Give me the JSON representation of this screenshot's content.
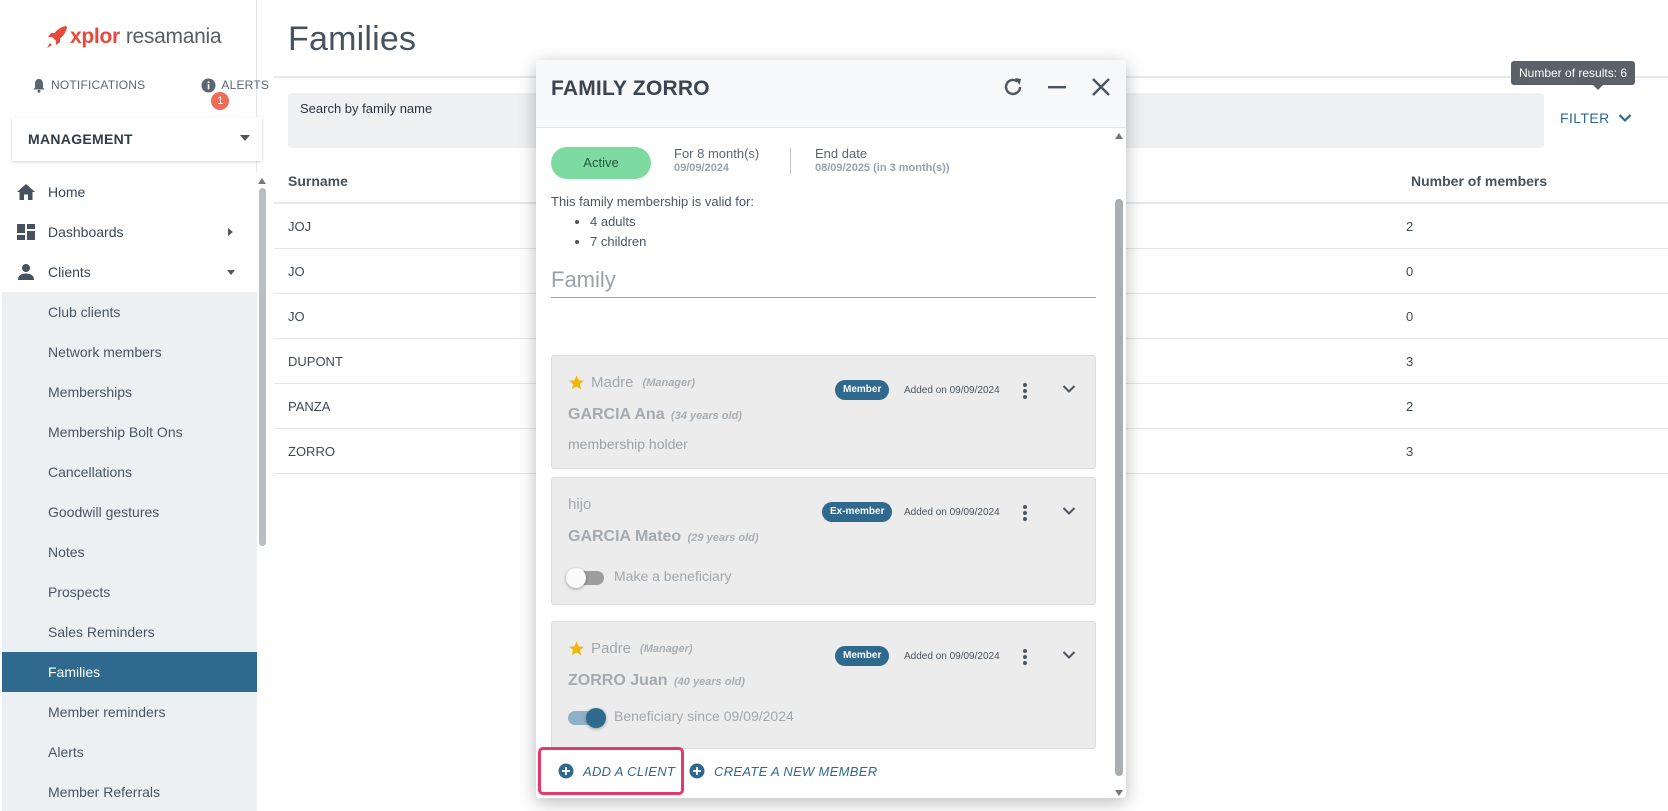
{
  "app": {
    "brand_part1": "xplor",
    "brand_part2": "resamania"
  },
  "topbar": {
    "notifications_label": "NOTIFICATIONS",
    "alerts_label": "ALERTS",
    "alerts_count": "1"
  },
  "section_select": {
    "label": "MANAGEMENT"
  },
  "nav": {
    "home": "Home",
    "dashboards": "Dashboards",
    "clients": "Clients",
    "sub": [
      "Club clients",
      "Network members",
      "Memberships",
      "Membership Bolt Ons",
      "Cancellations",
      "Goodwill gestures",
      "Notes",
      "Prospects",
      "Sales Reminders",
      "Families",
      "Member reminders",
      "Alerts",
      "Member Referrals"
    ],
    "active_index": 9
  },
  "main": {
    "title": "Families",
    "search_placeholder": "Search by family name",
    "filter_label": "FILTER",
    "results_tooltip": "Number of results: 6",
    "columns": {
      "surname": "Surname",
      "members": "Number of members"
    },
    "rows": [
      {
        "surname": "JOJ",
        "members": "2"
      },
      {
        "surname": "JO",
        "members": "0"
      },
      {
        "surname": "JO",
        "members": "0"
      },
      {
        "surname": "DUPONT",
        "members": "3"
      },
      {
        "surname": "PANZA",
        "members": "2"
      },
      {
        "surname": "ZORRO",
        "members": "3"
      }
    ]
  },
  "dialog": {
    "title": "FAMILY ZORRO",
    "status": "Active",
    "duration": "For 8 month(s)",
    "start_date": "09/09/2024",
    "end_label": "End date",
    "end_date": "08/09/2025 (in 3 month(s))",
    "valid_text": "This family membership is valid for:",
    "valid_items": [
      "4 adults",
      "7 children"
    ],
    "family_heading": "Family",
    "members": [
      {
        "role": "Madre",
        "manager_tag": "(Manager)",
        "name": "GARCIA Ana",
        "age": "(34 years old)",
        "badge": "Member",
        "added": "Added on 09/09/2024",
        "note": "membership holder"
      },
      {
        "role": "hijo",
        "name": "GARCIA Mateo",
        "age": "(29 years old)",
        "badge": "Ex-member",
        "added": "Added on 09/09/2024",
        "toggle_label": "Make a beneficiary",
        "toggle_on": false
      },
      {
        "role": "Padre",
        "manager_tag": "(Manager)",
        "name": "ZORRO Juan",
        "age": "(40 years old)",
        "badge": "Member",
        "added": "Added on 09/09/2024",
        "toggle_label": "Beneficiary since 09/09/2024",
        "toggle_on": true
      }
    ],
    "add_client_label": "ADD A CLIENT",
    "create_member_label": "CREATE A NEW MEMBER"
  },
  "colors": {
    "accent": "#2f6a8e",
    "logo_red": "#e9483b",
    "active_green": "#7ddba1",
    "highlight": "#e8386a",
    "star": "#f2b705"
  }
}
